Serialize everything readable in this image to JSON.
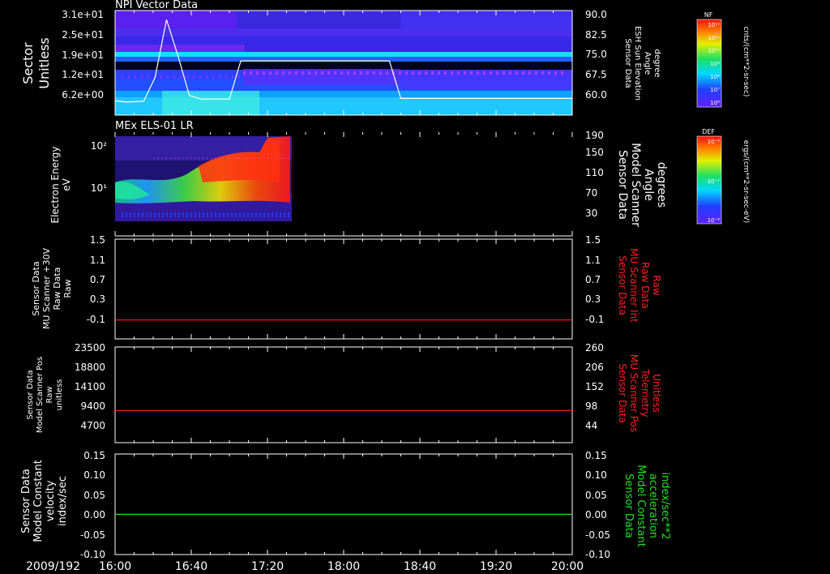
{
  "date_label": "2009/192",
  "x_ticks": [
    "16:00",
    "16:40",
    "17:20",
    "18:00",
    "18:40",
    "19:20",
    "20:00"
  ],
  "colors": {
    "white": "#ffffff",
    "red": "#ff2020",
    "green": "#20e020",
    "bg": "#000000"
  },
  "chart_data": [
    {
      "type": "heatmap",
      "title": "NPI Vector Data",
      "ylabel": [
        "Sector",
        "Unitless"
      ],
      "y_ticks": [
        "3.1e+01",
        "2.5e+01",
        "1.9e+01",
        "1.2e+01",
        "6.2e+00"
      ],
      "y2_label": [
        "Sensor Data",
        "ESH Sun Elevation",
        "Angle",
        "degree"
      ],
      "y2_ticks": [
        "90.0",
        "82.5",
        "75.0",
        "67.5",
        "60.0"
      ],
      "y2_range": [
        55.5,
        90.0
      ],
      "colorbar": {
        "label": "NF",
        "units": "cnts/(cm**2-sr-sec)",
        "ticks": [
          "10¹²",
          "10¹¹",
          "10¹⁰",
          "10⁹",
          "10⁸",
          "10⁷",
          "10⁶"
        ]
      },
      "line_series": {
        "time_h": [
          16.0,
          16.1,
          16.25,
          16.35,
          16.45,
          16.55,
          16.65,
          16.75,
          16.85,
          17.0,
          17.1,
          17.4,
          17.6,
          17.8,
          18.2,
          18.4,
          18.5,
          18.6,
          19.0,
          20.0
        ],
        "values": [
          60.2,
          59.8,
          60.1,
          68,
          87,
          75,
          62,
          60.8,
          60.8,
          60.8,
          73.4,
          73.4,
          73.4,
          73.4,
          73.4,
          73.4,
          61,
          61,
          61,
          61
        ]
      }
    },
    {
      "type": "heatmap",
      "title": "MEx ELS-01 LR",
      "ylabel": [
        "Electron Energy",
        "eV"
      ],
      "y_ticks": [
        "10²",
        "10¹"
      ],
      "y2_label": [
        "Sensor Data",
        "Model Scanner",
        "Angle",
        "degrees"
      ],
      "y2_ticks": [
        "190",
        "150",
        "110",
        "70",
        "30"
      ],
      "y2_range": [
        10,
        190
      ],
      "colorbar": {
        "label": "DEF",
        "units": "ergs/(cm**2-sr-sec-eV)",
        "ticks": [
          "10⁻⁶",
          "10⁻⁷",
          "10⁻⁸"
        ]
      },
      "data_time_range": [
        16.0,
        17.45
      ],
      "line_value": 10
    },
    {
      "type": "line",
      "ylabel": [
        "Sensor Data",
        "MU Scanner +30V",
        "Raw Data",
        "Raw"
      ],
      "y_ticks": [
        "1.5",
        "1.1",
        "0.7",
        "0.3",
        "-0.1"
      ],
      "y_range": [
        -0.35,
        1.5
      ],
      "y2_label": [
        "Sensor Data",
        "MU Scanner Int",
        "Raw Data",
        "Raw"
      ],
      "y2_ticks": [
        "1.5",
        "1.1",
        "0.7",
        "0.3",
        "-0.1"
      ],
      "value": 0.0,
      "color": "#ff2020"
    },
    {
      "type": "line",
      "ylabel": [
        "Sensor Data",
        "Model Scanner Pos",
        "Raw",
        "unitless"
      ],
      "y_ticks": [
        "23500",
        "18800",
        "14100",
        "9400",
        "4700"
      ],
      "y_range": [
        0,
        23500
      ],
      "y2_label": [
        "Sensor Data",
        "MU Scanner Pos",
        "Telemetry",
        "Unitless"
      ],
      "y2_ticks": [
        "260",
        "206",
        "152",
        "98",
        "44"
      ],
      "value": 7900,
      "color": "#ff2020"
    },
    {
      "type": "line",
      "ylabel": [
        "Sensor Data",
        "Model Constant",
        "velocity",
        "index/sec"
      ],
      "y_ticks": [
        "0.15",
        "0.10",
        "0.05",
        "0.00",
        "-0.05",
        "-0.10"
      ],
      "y_range": [
        -0.1,
        0.15
      ],
      "y2_label": [
        "Sensor Data",
        "Model Constant",
        "acceleration",
        "index/sec**2"
      ],
      "y2_ticks": [
        "0.15",
        "0.10",
        "0.05",
        "0.00",
        "-0.05",
        "-0.10"
      ],
      "value": 0.0,
      "color": "#20e020"
    }
  ]
}
